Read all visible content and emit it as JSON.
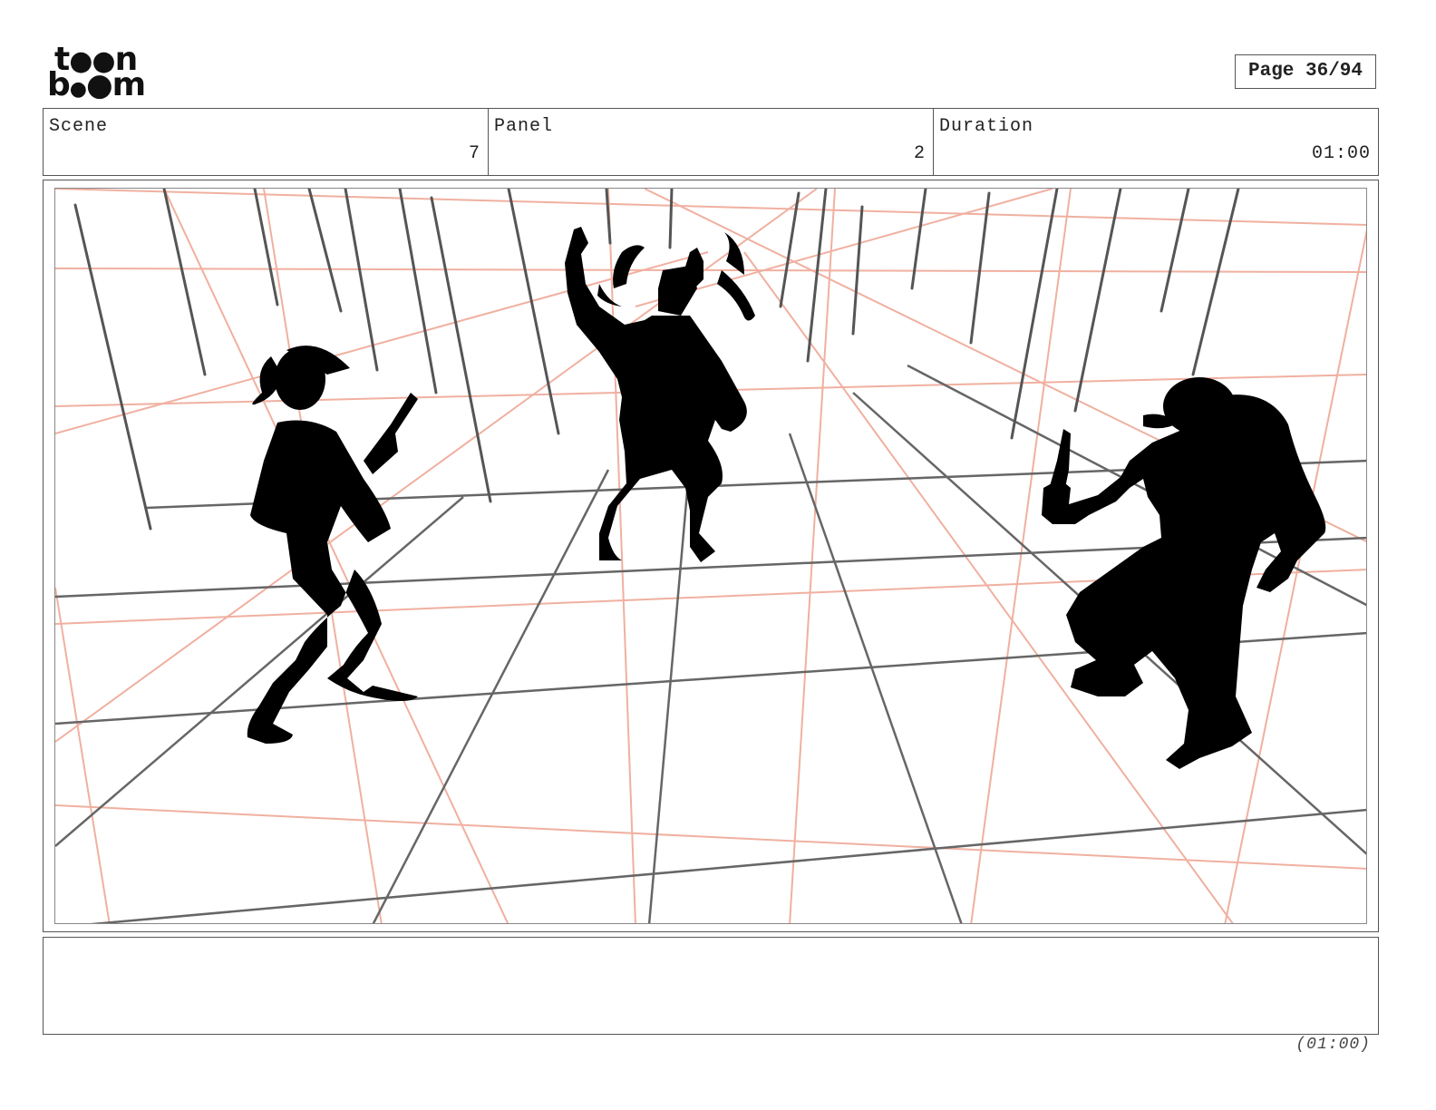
{
  "logo": {
    "row1": "to•n",
    "row2": "b•om",
    "alt": "toon boom"
  },
  "page": {
    "label": "Page 36/94"
  },
  "header": {
    "scene_label": "Scene",
    "scene_value": "7",
    "panel_label": "Panel",
    "panel_value": "2",
    "duration_label": "Duration",
    "duration_value": "01:00"
  },
  "panel": {
    "content": "storyboard sketch: three silhouetted figures on a perspective grid floor"
  },
  "notes": {
    "text": ""
  },
  "footer": {
    "duration": "(01:00)"
  },
  "colors": {
    "guide_red": "#f0b0a0",
    "grid_gray": "#666666",
    "silhouette": "#000000"
  }
}
